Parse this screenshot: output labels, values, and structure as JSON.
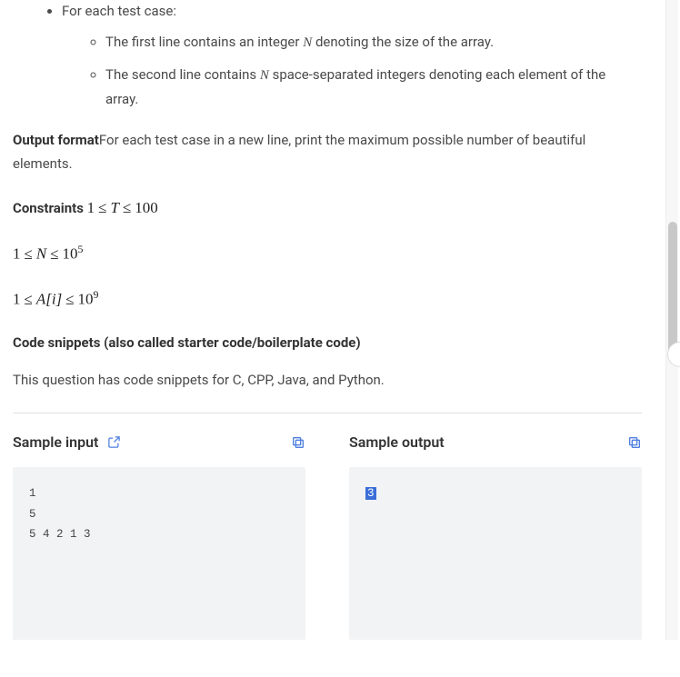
{
  "bullets": {
    "top": "For each test case:",
    "sub1_a": "The first line contains an integer ",
    "sub1_var": "N",
    "sub1_b": " denoting the size of the array.",
    "sub2_a": "The second line contains ",
    "sub2_var": "N",
    "sub2_b": " space-separated integers denoting each element of the array."
  },
  "output": {
    "label": "Output format",
    "text": "For each test case in a new line, print the maximum possible number of beautiful elements."
  },
  "constraints": {
    "label": "Constraints",
    "c1_a": "1",
    "c1_le1": "≤",
    "c1_var": "T",
    "c1_le2": "≤",
    "c1_b": "100",
    "c2_a": "1",
    "c2_le1": "≤",
    "c2_var": "N",
    "c2_le2": "≤",
    "c2_base": "10",
    "c2_exp": "5",
    "c3_a": "1",
    "c3_le1": "≤",
    "c3_var": "A[i]",
    "c3_le2": "≤",
    "c3_base": "10",
    "c3_exp": "9"
  },
  "snippets": {
    "heading": "Code snippets (also called starter code/boilerplate code)",
    "text": "This question has code snippets for C, CPP, Java, and Python."
  },
  "samples": {
    "input_label": "Sample input",
    "output_label": "Sample output",
    "input_text": "1\n5\n5 4 2 1 3",
    "output_text": "3"
  },
  "colors": {
    "highlight_bg": "#3b6ed8",
    "icon_blue": "#4f7fe0",
    "icon_gray": "#4f7fe0"
  }
}
